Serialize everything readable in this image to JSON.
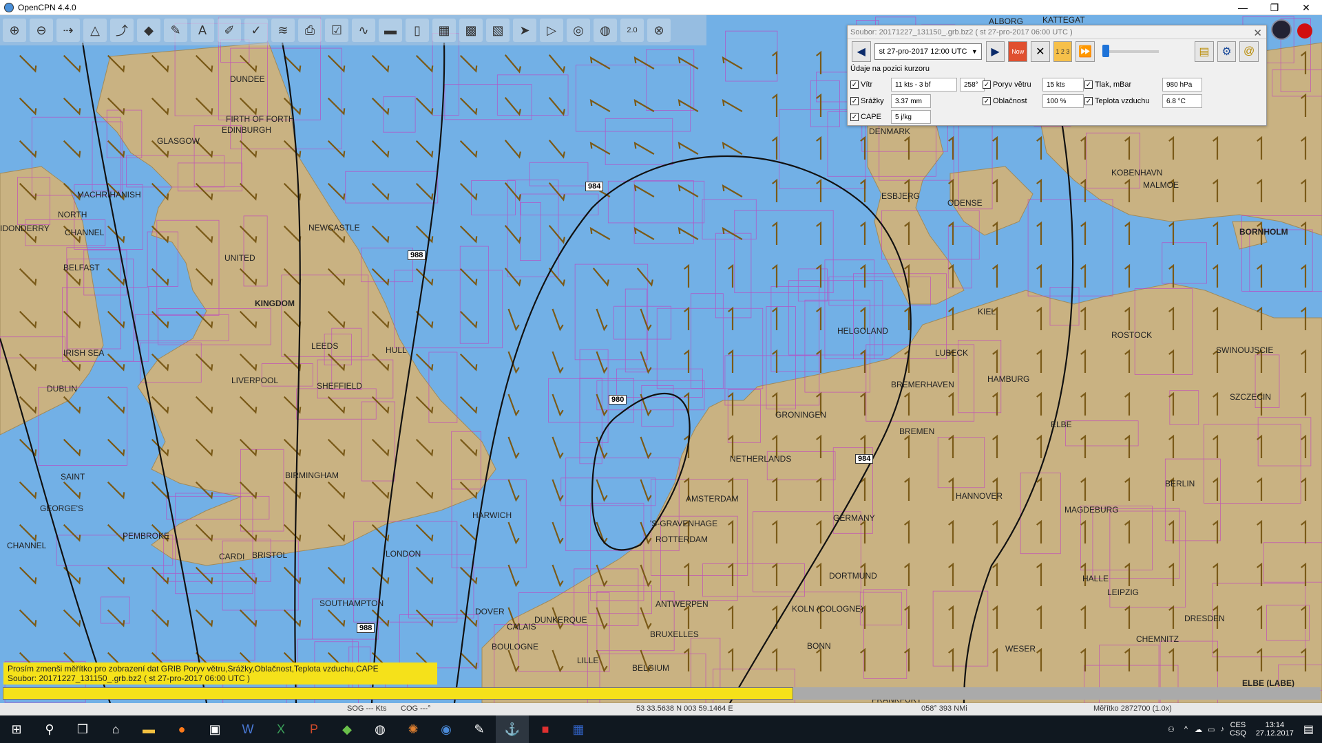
{
  "window": {
    "title": "OpenCPN 4.4.0",
    "minimize": "—",
    "restore": "❐",
    "close": "✕"
  },
  "toolbar": {
    "icons": [
      "zoom-in-icon",
      "zoom-out-icon",
      "route-icon",
      "waypoint-icon",
      "track-icon",
      "color-icon",
      "tools-icon",
      "text-icon",
      "pencil-icon",
      "mark-icon",
      "layer-icon",
      "print-icon",
      "check-icon",
      "path-icon",
      "folder-icon",
      "doc-icon",
      "chart-icon",
      "grid-icon",
      "map-icon",
      "send-icon",
      "play-icon",
      "ais-icon",
      "globe-icon",
      "scale-icon",
      "rescue-icon"
    ],
    "zoom_label": "2.0"
  },
  "grib": {
    "file_header": "Soubor: 20171227_131150_.grb.bz2 ( st 27-pro-2017 06:00  UTC )",
    "close": "✕",
    "timestamp": "st 27-pro-2017 12:00  UTC",
    "cursor_label": "Údaje na pozici kurzoru",
    "wind": {
      "label": "Vítr",
      "value": "11 kts - 3 bf",
      "dir": "258°"
    },
    "gust": {
      "label": "Poryv větru",
      "value": "15 kts"
    },
    "pressure": {
      "label": "Tlak, mBar",
      "value": "980 hPa"
    },
    "precip": {
      "label": "Srážky",
      "value": "3.37 mm"
    },
    "cloud": {
      "label": "Oblačnost",
      "value": "100 %"
    },
    "temp": {
      "label": "Teplota vzduchu",
      "value": "6.8 °C"
    },
    "cape": {
      "label": "CAPE",
      "value": "5 j/kg"
    },
    "btn_now": "Now",
    "btn_num": "1 2 3"
  },
  "map_labels": {
    "dundee": "Dundee",
    "firth": "FIRTH OF FORTH",
    "edinburgh": "Edinburgh",
    "glasgow": "Glasgow",
    "machrihanish": "Machrihanish",
    "north": "NORTH",
    "channel_n": "CHANNEL",
    "londonderry": "IDONDERRY",
    "belfast": "Belfast",
    "united": "UNITED",
    "kingdom": "KINGDOM",
    "newcastle": "Newcastle",
    "irish_sea": "IRISH SEA",
    "dublin": "Dublin",
    "leeds": "Leeds",
    "hull": "Hull",
    "liverpool": "Liverpool",
    "sheffield": "Sheffield",
    "birmingham": "Birmingham",
    "saint": "SAINT",
    "georges": "GEORGE'S",
    "channel_s": "CHANNEL",
    "pembroke": "Pembroke",
    "cardiff": "Cardi",
    "bristol": "Bristol",
    "london": "London",
    "harwich": "Harwich",
    "southampton": "Southampton",
    "dover": "Dover",
    "calais": "Calais",
    "dunkerque": "Dunkerque",
    "boulogne": "Boulogne",
    "lille": "Lille",
    "belgium": "BELGIUM",
    "bruxelles": "Bruxelles",
    "antwerpen": "Antwerpen",
    "rotterdam": "Rotterdam",
    "gravenhage": "'s-Gravenhage",
    "amsterdam": "Amsterdam",
    "netherlands": "NETHERLANDS",
    "groningen": "Groningen",
    "helgoland": "Helgoland",
    "bremerhaven": "Bremerhaven",
    "bremen": "Bremen",
    "hamburg": "Hamburg",
    "lubeck": "Lubeck",
    "kiel": "Kiel",
    "rostock": "Rostock",
    "esbjerg": "Esbjerg",
    "odense": "Odense",
    "kobenhavn": "Kobenhavn",
    "malmoe": "Malmoe",
    "bornholm": "BORNHOLM",
    "swinoujscie": "Swinoujscie",
    "szczecin": "Szczecin",
    "elbe": "Elbe",
    "hannover": "Hannover",
    "berlin": "Berlin",
    "magdeburg": "Magdeburg",
    "germany": "GERMANY",
    "dortmund": "Dortmund",
    "halle": "Halle",
    "leipzig": "Leipzig",
    "koln": "Koln (Cologne)",
    "bonn": "Bonn",
    "weser": "Weser",
    "dresden": "Dresden",
    "chemnitz": "Chemnitz",
    "elbe_labe": "ELBE (LABE)",
    "europe": "EUROPE",
    "frankfurt": "Frankfurt",
    "denmark": "DENMARK",
    "alborg": "Alborg",
    "kattegat": "KATTEGAT"
  },
  "isobars": {
    "i984a": "984",
    "i988a": "988",
    "i980": "980",
    "i984b": "984",
    "i988b": "988"
  },
  "status_message": {
    "line1": "Prosím zmenši měřítko pro zobrazení dat GRIB Poryv větru,Srážky,Oblačnost,Teplota vzduchu,CAPE",
    "line2": "Soubor: 20171227_131150_.grb.bz2 ( st 27-pro-2017 06:00  UTC )"
  },
  "progress": 0.6,
  "statusbar": {
    "sog": "SOG --- Kts",
    "cog": "COG ---°",
    "position": "53 33.5638 N   003 59.1464 E",
    "bearing": "058°  393 NMi",
    "scale": "Měřítko 2872700 (1.0x)"
  },
  "taskbar": {
    "lang": "CES",
    "lang2": "CSQ",
    "time": "13:14",
    "date": "27.12.2017"
  },
  "colors": {
    "sea": "#72b0e6",
    "land": "#c9b282",
    "chart_outline": "#c040c0",
    "arrow": "#7a5a18"
  }
}
